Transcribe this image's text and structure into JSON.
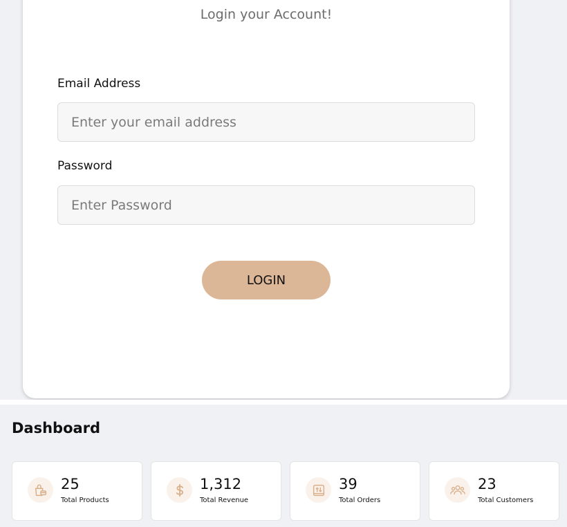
{
  "login": {
    "title": "Login your Account!",
    "email_label": "Email Address",
    "email_placeholder": "Enter your email address",
    "email_value": "",
    "password_label": "Password",
    "password_placeholder": "Enter Password",
    "password_value": "",
    "button_label": "LOGIN"
  },
  "dashboard": {
    "title": "Dashboard",
    "stats": [
      {
        "value": "25",
        "label": "Total Products",
        "icon": "shopping-bag-icon"
      },
      {
        "value": "1,312",
        "label": "Total Revenue",
        "icon": "dollar-icon"
      },
      {
        "value": "39",
        "label": "Total Orders",
        "icon": "package-icon"
      },
      {
        "value": "23",
        "label": "Total Customers",
        "icon": "users-icon"
      }
    ]
  },
  "colors": {
    "accent": "#dcb797",
    "icon": "#d8b08c",
    "icon_bg": "#faf2ea",
    "page_bg": "#f0f1f5"
  }
}
